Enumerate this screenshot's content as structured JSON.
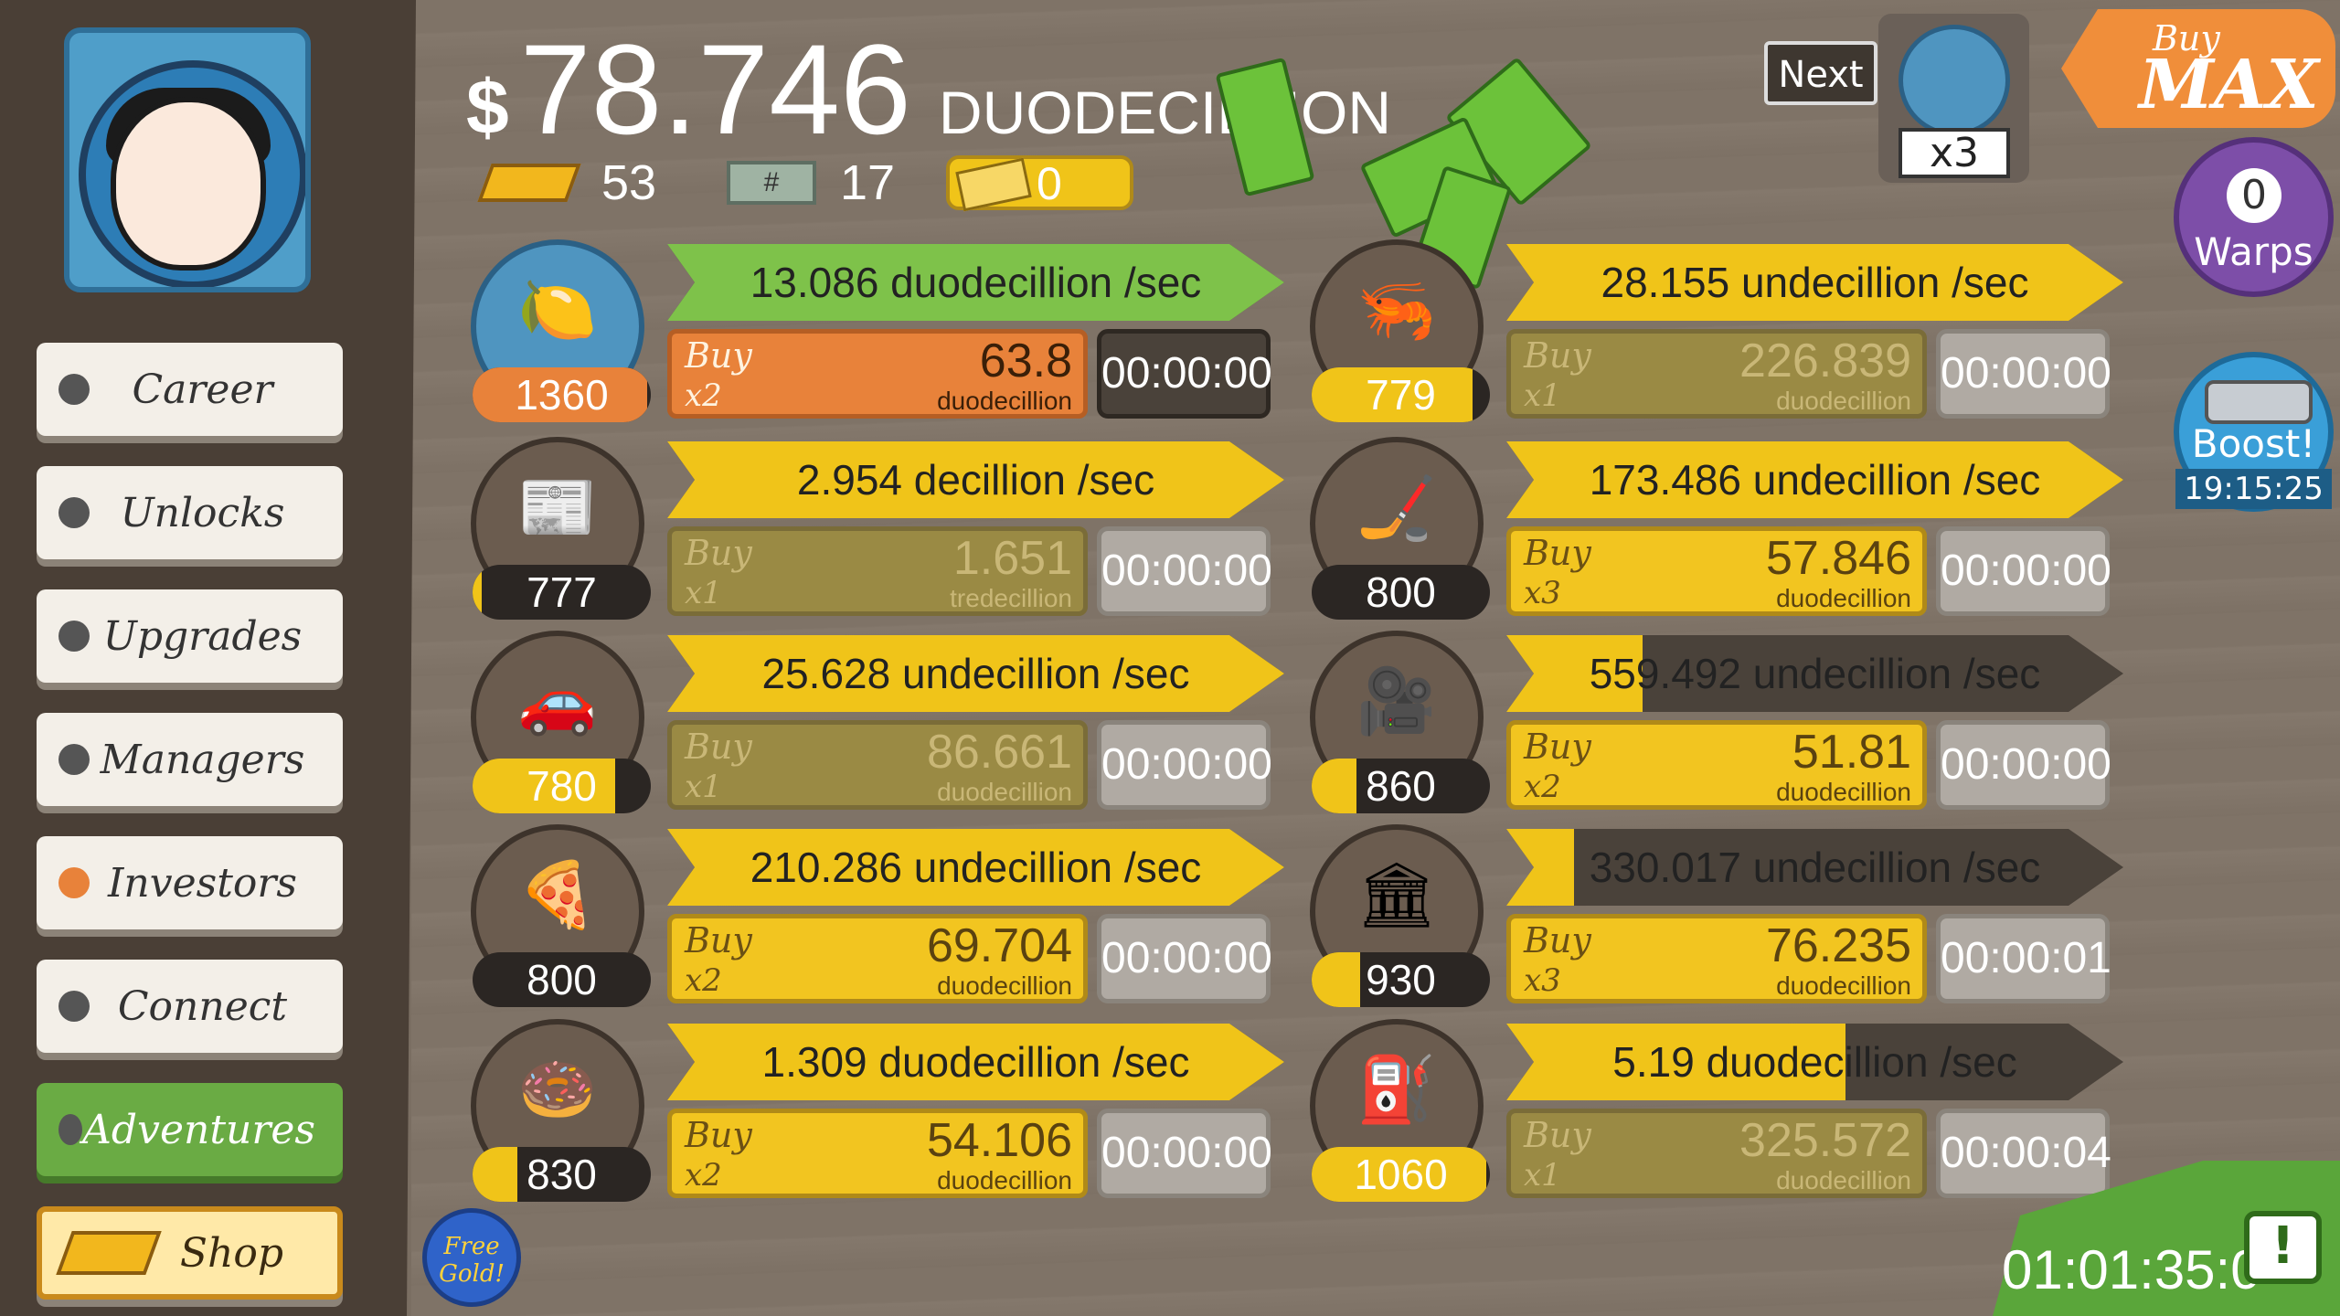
{
  "header": {
    "currency_symbol": "$",
    "money_amount": "78.746",
    "money_unit": "DUODECILLION",
    "gold": "53",
    "megabucks": "17",
    "tickets": "0"
  },
  "nav": {
    "career": "Career",
    "unlocks": "Unlocks",
    "upgrades": "Upgrades",
    "managers": "Managers",
    "investors": "Investors",
    "connect": "Connect",
    "adventures": "Adventures",
    "shop": "Shop"
  },
  "businesses": [
    {
      "icon": "lemon-icon",
      "level": "1360",
      "level_progress": 0.98,
      "rate": "13.086 duodecillion /sec",
      "rate_progress": 1.0,
      "buy_label": "Buy",
      "buy_mult": "x2",
      "cost": "63.8",
      "cost_unit": "duodecillion",
      "timer": "00:00:00",
      "state": "orange"
    },
    {
      "icon": "newspaper-icon",
      "level": "777",
      "level_progress": 0.05,
      "rate": "2.954 decillion /sec",
      "rate_progress": 1.0,
      "buy_label": "Buy",
      "buy_mult": "x1",
      "cost": "1.651",
      "cost_unit": "tredecillion",
      "timer": "00:00:00",
      "state": "dim"
    },
    {
      "icon": "car-wash-icon",
      "level": "780",
      "level_progress": 0.8,
      "rate": "25.628 undecillion /sec",
      "rate_progress": 1.0,
      "buy_label": "Buy",
      "buy_mult": "x1",
      "cost": "86.661",
      "cost_unit": "duodecillion",
      "timer": "00:00:00",
      "state": "dim"
    },
    {
      "icon": "pizza-icon",
      "level": "800",
      "level_progress": 0.0,
      "rate": "210.286 undecillion /sec",
      "rate_progress": 1.0,
      "buy_label": "Buy",
      "buy_mult": "x2",
      "cost": "69.704",
      "cost_unit": "duodecillion",
      "timer": "00:00:00",
      "state": "yellow"
    },
    {
      "icon": "donut-icon",
      "level": "830",
      "level_progress": 0.25,
      "rate": "1.309 duodecillion /sec",
      "rate_progress": 1.0,
      "buy_label": "Buy",
      "buy_mult": "x2",
      "cost": "54.106",
      "cost_unit": "duodecillion",
      "timer": "00:00:00",
      "state": "yellow"
    },
    {
      "icon": "shrimp-icon",
      "level": "779",
      "level_progress": 0.9,
      "rate": "28.155 undecillion /sec",
      "rate_progress": 1.0,
      "buy_label": "Buy",
      "buy_mult": "x1",
      "cost": "226.839",
      "cost_unit": "duodecillion",
      "timer": "00:00:00",
      "state": "dim"
    },
    {
      "icon": "hockey-icon",
      "level": "800",
      "level_progress": 0.0,
      "rate": "173.486 undecillion /sec",
      "rate_progress": 1.0,
      "buy_label": "Buy",
      "buy_mult": "x3",
      "cost": "57.846",
      "cost_unit": "duodecillion",
      "timer": "00:00:00",
      "state": "yellow"
    },
    {
      "icon": "movie-camera-icon",
      "level": "860",
      "level_progress": 0.25,
      "rate": "559.492 undecillion /sec",
      "rate_progress": 0.22,
      "buy_label": "Buy",
      "buy_mult": "x2",
      "cost": "51.81",
      "cost_unit": "duodecillion",
      "timer": "00:00:00",
      "state": "yellow"
    },
    {
      "icon": "bank-icon",
      "level": "930",
      "level_progress": 0.27,
      "rate": "330.017 undecillion /sec",
      "rate_progress": 0.11,
      "buy_label": "Buy",
      "buy_mult": "x3",
      "cost": "76.235",
      "cost_unit": "duodecillion",
      "timer": "00:00:01",
      "state": "yellow"
    },
    {
      "icon": "oil-rig-icon",
      "level": "1060",
      "level_progress": 0.98,
      "rate": "5.19 duodecillion /sec",
      "rate_progress": 0.55,
      "buy_label": "Buy",
      "buy_mult": "x1",
      "cost": "325.572",
      "cost_unit": "duodecillion",
      "timer": "00:00:04",
      "state": "dim"
    }
  ],
  "widgets": {
    "next_label": "Next",
    "news_multiplier": "x3",
    "buy_max_top": "Buy",
    "buy_max_bottom": "MAX",
    "warps_count": "0",
    "warps_label": "Warps",
    "boost_label": "Boost!",
    "boost_timer": "19:15:25",
    "free_gold": "Free Gold!",
    "adventure_timer": "01:01:35:0",
    "alert_mark": "!"
  },
  "colors": {
    "accent_yellow": "#f0c419",
    "accent_green": "#7ec24a",
    "accent_orange": "#e8823a"
  }
}
